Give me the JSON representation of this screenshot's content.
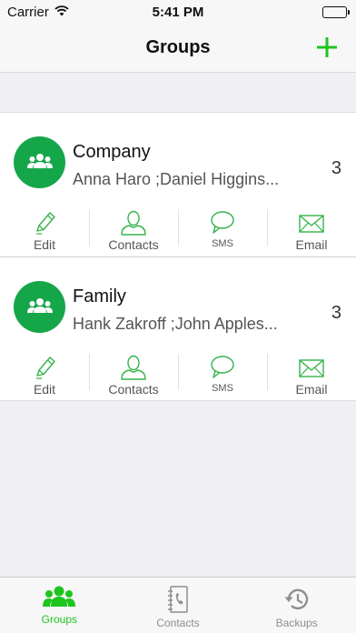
{
  "status_bar": {
    "carrier": "Carrier",
    "time": "5:41 PM"
  },
  "nav": {
    "title": "Groups",
    "add_icon": "plus-icon"
  },
  "colors": {
    "accent": "#1fc51f",
    "avatar": "#16a64a",
    "icon_line": "#34b34a"
  },
  "groups": [
    {
      "name": "Company",
      "members": "Anna Haro ;Daniel Higgins...",
      "count": "3",
      "actions": {
        "edit": "Edit",
        "contacts": "Contacts",
        "sms": "SMS",
        "email": "Email"
      }
    },
    {
      "name": "Family",
      "members": "Hank Zakroff ;John Apples...",
      "count": "3",
      "actions": {
        "edit": "Edit",
        "contacts": "Contacts",
        "sms": "SMS",
        "email": "Email"
      }
    }
  ],
  "tabs": [
    {
      "label": "Groups",
      "icon": "groups-icon",
      "active": true
    },
    {
      "label": "Contacts",
      "icon": "address-book-icon",
      "active": false
    },
    {
      "label": "Backups",
      "icon": "history-icon",
      "active": false
    }
  ]
}
